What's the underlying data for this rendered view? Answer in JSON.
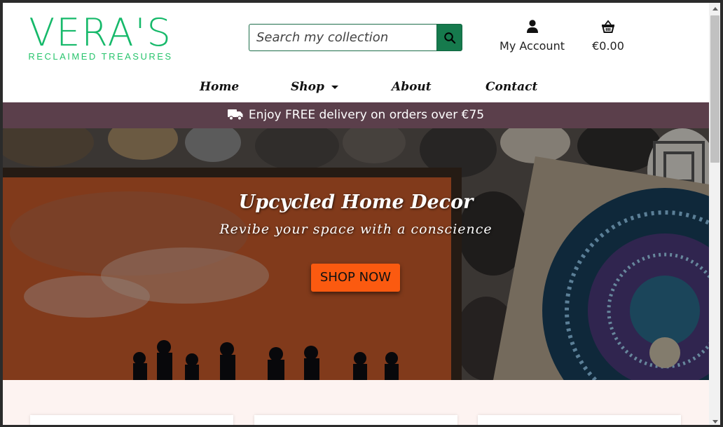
{
  "logo": {
    "title": "VERA'S",
    "subtitle": "RECLAIMED TREASURES"
  },
  "search": {
    "placeholder": "Search my collection",
    "value": "",
    "button_icon": "search-icon"
  },
  "account": {
    "label": "My Account",
    "icon": "user-icon"
  },
  "cart": {
    "total": "€0.00",
    "icon": "basket-icon"
  },
  "nav": {
    "items": [
      {
        "label": "Home"
      },
      {
        "label": "Shop",
        "has_dropdown": true
      },
      {
        "label": "About"
      },
      {
        "label": "Contact"
      }
    ]
  },
  "delivery_banner": {
    "text": "Enjoy FREE delivery on orders over €75",
    "icon": "truck-icon"
  },
  "hero": {
    "title": "Upcycled Home Decor",
    "subtitle": "Revibe your space with a conscience",
    "button_label": "SHOP NOW"
  },
  "colors": {
    "brand_green": "#16b96a",
    "search_button": "#167a4d",
    "delivery_banner_bg": "#5b3f4b",
    "cta_orange": "#fb5a10",
    "section_bg": "#fdf3f1"
  }
}
